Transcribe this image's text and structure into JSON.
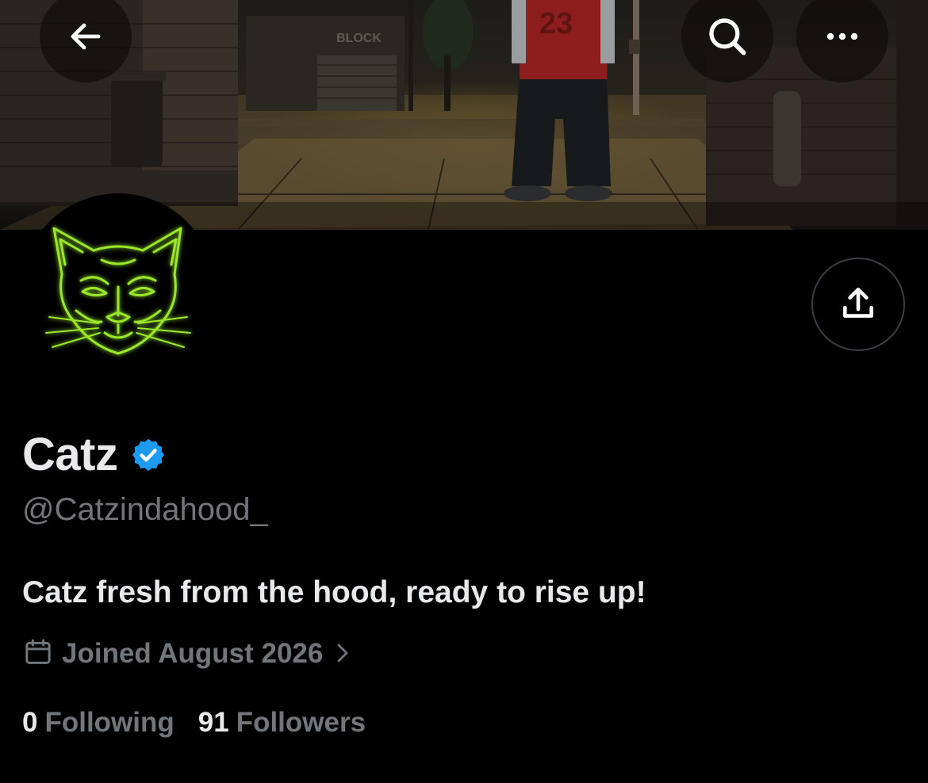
{
  "profile": {
    "display_name": "Catz",
    "handle": "@Catzindahood_",
    "bio": "Catz fresh from the hood, ready to rise up!",
    "joined": "Joined August 2026",
    "verified": true,
    "stats": {
      "following_count": "0",
      "following_label": "Following",
      "followers_count": "91",
      "followers_label": "Followers"
    }
  },
  "banner": {
    "sign_text": "BLOCK",
    "jersey_number": "23"
  },
  "header": {
    "back_icon": "arrow-left-icon",
    "search_icon": "search-icon",
    "more_icon": "more-horizontal-icon"
  },
  "actions": {
    "share_icon": "share-upload-icon"
  },
  "colors": {
    "background": "#000000",
    "primary_text": "#e7e9ea",
    "secondary_text": "#71767b",
    "verified_blue": "#1d9bf0",
    "avatar_neon": "#9be82a",
    "button_border": "#3a3f44"
  }
}
